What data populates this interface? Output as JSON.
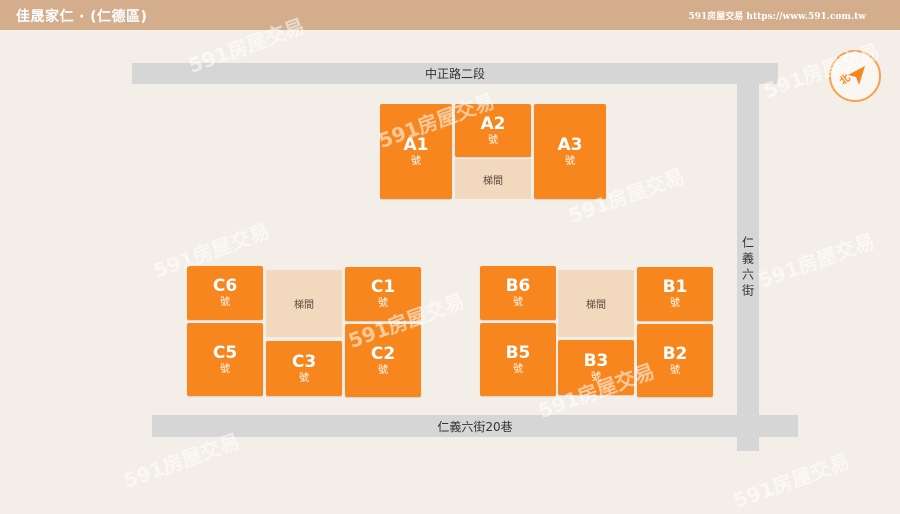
{
  "header": {
    "title": "佳晟家仁 ‧ (仁德區)",
    "site": "591房屋交易 https://www.591.com.tw",
    "background_color": "#d3ad8c"
  },
  "roads": {
    "top": "中正路二段",
    "right": "仁義六街",
    "bottom": "仁義六街20巷"
  },
  "compass": {
    "label": "北",
    "icon": "north-arrow-icon"
  },
  "unit_suffix": "號",
  "stair_label": "梯間",
  "buildings": {
    "a": [
      "A1",
      "A2",
      "A3"
    ],
    "b": [
      "B1",
      "B2",
      "B3",
      "B5",
      "B6"
    ],
    "c": [
      "C1",
      "C2",
      "C3",
      "C5",
      "C6"
    ]
  },
  "watermark": "591房屋交易",
  "colors": {
    "unit": "#f7861e",
    "stair": "#f2d9be",
    "road": "#d6d6d6",
    "background": "#f3eee8"
  }
}
